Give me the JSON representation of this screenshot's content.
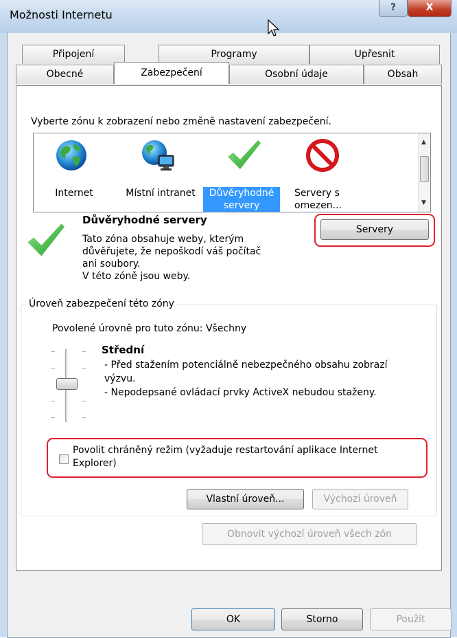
{
  "window": {
    "title": "Možnosti Internetu",
    "help": "?",
    "close": "X"
  },
  "tabs_top": [
    "Připojení",
    "Programy",
    "Upřesnit"
  ],
  "tabs_bottom": [
    "Obecné",
    "Zabezpečení",
    "Osobní údaje",
    "Obsah"
  ],
  "active_tab": "Zabezpečení",
  "zone_prompt": "Vyberte zónu k zobrazení nebo změně nastavení zabezpečení.",
  "zones": [
    {
      "label_1": "Internet",
      "label_2": "",
      "icon": "globe-icon"
    },
    {
      "label_1": "Místní intranet",
      "label_2": "",
      "icon": "intranet-icon"
    },
    {
      "label_1": "Důvěryhodné",
      "label_2": "servery",
      "icon": "checkmark-icon",
      "selected": true
    },
    {
      "label_1": "Servery s",
      "label_2": "omezen...",
      "icon": "restricted-icon"
    }
  ],
  "zone_info": {
    "title": "Důvěryhodné servery",
    "desc_1": "Tato zóna obsahuje weby, kterým",
    "desc_2": "důvěřujete, že nepoškodí váš počítač",
    "desc_3": "ani soubory.",
    "desc_4": "V této zóně jsou weby."
  },
  "servers_button": "Servery",
  "security_level": {
    "group_title": "Úroveň zabezpečení této zóny",
    "allowed": "Povolené úrovně pro tuto zónu: Všechny",
    "level_name": "Střední",
    "line_1": "- Před stažením potenciálně nebezpečného obsahu zobrazí",
    "line_2": "výzvu.",
    "line_3": "- Nepodepsané ovládací prvky ActiveX nebudou staženy.",
    "slider_level": 0.5
  },
  "protected_mode": {
    "label_1": "Povolit chráněný režim (vyžaduje restartování aplikace Internet",
    "label_2": "Explorer)",
    "checked": false
  },
  "buttons": {
    "custom_level": "Vlastní úroveň...",
    "default_level": "Výchozí úroveň",
    "reset_all": "Obnovit výchozí úroveň všech zón",
    "ok": "OK",
    "cancel": "Storno",
    "apply": "Použít"
  },
  "colors": {
    "accent_selection": "#3399ff",
    "highlight_red": "#e0202b",
    "check_green": "#3cb83c"
  }
}
